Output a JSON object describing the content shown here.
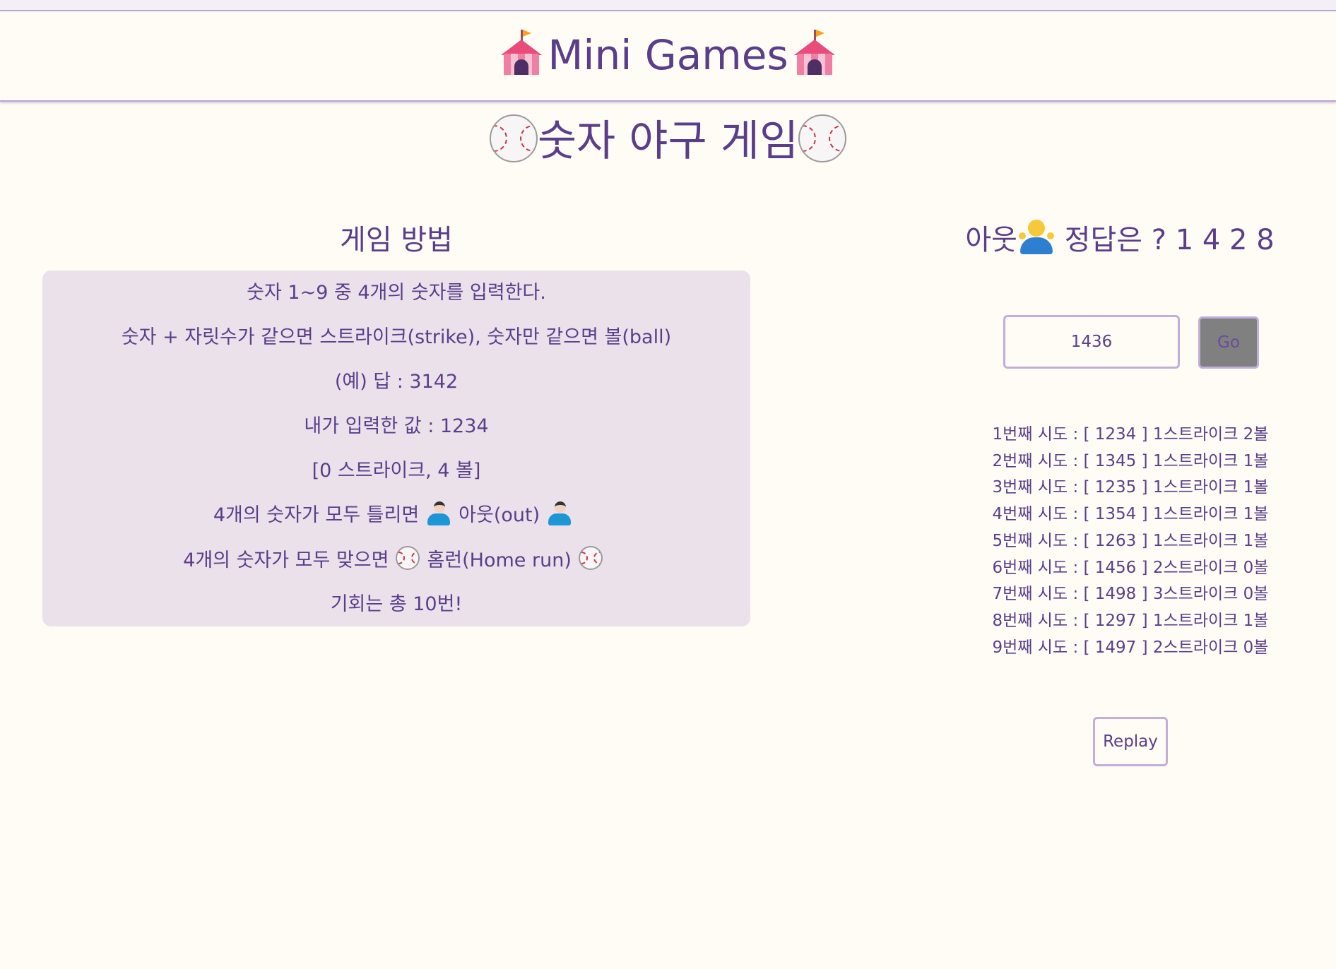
{
  "header": {
    "title": "Mini Games",
    "icon": "circus-tent-icon"
  },
  "game": {
    "title": "숫자 야구 게임",
    "icon": "baseball-icon"
  },
  "rules": {
    "heading": "게임 방법",
    "lines": [
      "숫자 1~9 중 4개의 숫자를 입력한다.",
      "숫자 + 자릿수가 같으면 스트라이크(strike), 숫자만 같으면 볼(ball)",
      "(예) 답 : 3142",
      "내가 입력한 값 : 1234",
      "[0 스트라이크, 4 볼]",
      "4개의 숫자가 모두 틀리면",
      "아웃(out)",
      "4개의 숫자가 모두 맞으면",
      "홈런(Home run)",
      "기회는 총 10번!"
    ]
  },
  "result": {
    "out_label": "아웃",
    "answer_label": "정답은 ? 1 4 2 8"
  },
  "input": {
    "value": "1436",
    "go_label": "Go"
  },
  "attempts": [
    "1번째 시도 : [ 1234 ] 1스트라이크 2볼",
    "2번째 시도 : [ 1345 ] 1스트라이크 1볼",
    "3번째 시도 : [ 1235 ] 1스트라이크 1볼",
    "4번째 시도 : [ 1354 ] 1스트라이크 1볼",
    "5번째 시도 : [ 1263 ] 1스트라이크 1볼",
    "6번째 시도 : [ 1456 ] 2스트라이크 0볼",
    "7번째 시도 : [ 1498 ] 3스트라이크 0볼",
    "8번째 시도 : [ 1297 ] 1스트라이크 1볼",
    "9번째 시도 : [ 1497 ] 2스트라이크 0볼"
  ],
  "replay_label": "Replay",
  "colors": {
    "text": "#5a3e8a",
    "background": "#fffcf5",
    "rules_box": "#ebe1ea",
    "border": "#c2aed8",
    "go_button": "#808080"
  }
}
